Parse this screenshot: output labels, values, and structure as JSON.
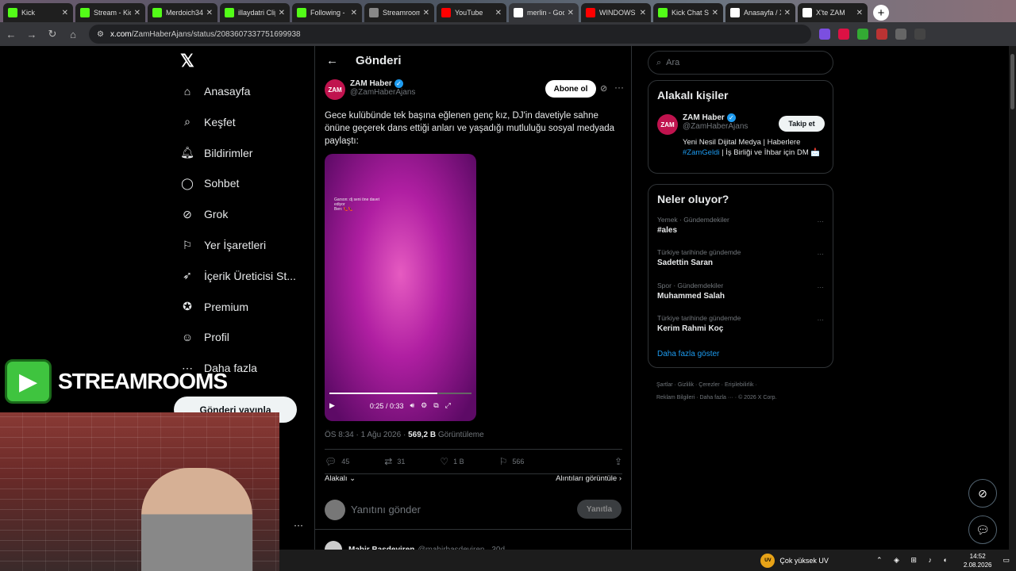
{
  "browser": {
    "tabs": [
      {
        "label": "Kick",
        "icon": "kick-icon",
        "color": "#53fc18"
      },
      {
        "label": "Stream - Kick",
        "icon": "kick-icon",
        "color": "#53fc18"
      },
      {
        "label": "Merdoich34",
        "icon": "kick-icon",
        "color": "#53fc18"
      },
      {
        "label": "illaydatri Clip",
        "icon": "kick-icon",
        "color": "#53fc18"
      },
      {
        "label": "Following -",
        "icon": "kick-icon",
        "color": "#53fc18"
      },
      {
        "label": "Streamroom",
        "icon": "streamroom-icon",
        "color": "#888888"
      },
      {
        "label": "YouTube",
        "icon": "youtube-icon",
        "color": "#ff0000"
      },
      {
        "label": "merlin - Goo",
        "icon": "google-icon",
        "color": "#ffffff"
      },
      {
        "label": "WINDOWS",
        "icon": "youtube-icon",
        "color": "#ff0000"
      },
      {
        "label": "Kick Chat Se",
        "icon": "kick-icon",
        "color": "#53fc18"
      },
      {
        "label": "Anasayfa / X",
        "icon": "x-icon",
        "color": "#ffffff"
      },
      {
        "label": "X'te ZAM",
        "icon": "x-icon",
        "color": "#ffffff"
      }
    ],
    "url_host": "x.com",
    "url_path": "/ZamHaberAjans/status/2083607337751699938"
  },
  "nav": {
    "items": [
      {
        "label": "Anasayfa",
        "icon": "home-icon"
      },
      {
        "label": "Keşfet",
        "icon": "search-icon"
      },
      {
        "label": "Bildirimler",
        "icon": "bell-icon"
      },
      {
        "label": "Sohbet",
        "icon": "chat-icon"
      },
      {
        "label": "Grok",
        "icon": "grok-icon"
      },
      {
        "label": "Yer İşaretleri",
        "icon": "bookmark-icon"
      },
      {
        "label": "İçerik Üreticisi St...",
        "icon": "rocket-icon"
      },
      {
        "label": "Premium",
        "icon": "verified-icon"
      },
      {
        "label": "Profil",
        "icon": "person-icon"
      },
      {
        "label": "Daha fazla",
        "icon": "more-icon"
      }
    ],
    "post_button": "Gönderi yayınla"
  },
  "post": {
    "header": "Gönderi",
    "author_name": "ZAM Haber",
    "author_handle": "@ZamHaberAjans",
    "avatar_text": "ZAM",
    "subscribe": "Abone ol",
    "text": "Gece kulübünde tek başına eğlenen genç kız, DJ'in davetiyle sahne önüne geçerek dans ettiği anları ve yaşadığı mutluluğu sosyal medyada paylaştı:",
    "video_caption_1": "Garson: dj seni öne davet",
    "video_caption_2": "ediyor",
    "video_caption_3": "Ben: 👠👠",
    "video_time": "0:25 / 0:33",
    "video_progress": 0.76,
    "timestamp": "ÖS 8:34 · 1 Ağu 2026 · ",
    "views": "569,2 B",
    "views_label": " Görüntüleme",
    "replies": "45",
    "reposts": "31",
    "likes": "1 B",
    "bookmarks": "566",
    "related": "Alakalı",
    "quotes": "Alıntıları görüntüle",
    "reply_placeholder": "Yanıtını gönder",
    "reply_button": "Yanıtla",
    "next_name": "Mahir Basdeviren",
    "next_handle": "@mahirbasdeviren · 30d"
  },
  "sidebar": {
    "search_placeholder": "Ara",
    "relevant_title": "Alakalı kişiler",
    "relevant_name": "ZAM Haber",
    "relevant_handle": "@ZamHaberAjans",
    "follow_button": "Takip et",
    "bio_1": "Yeni Nesil Dijital Medya | Haberlere",
    "bio_hashtag": "#ZamGeldi",
    "bio_2": " | İş Birliği ve İhbar için DM",
    "bio_3": "📩",
    "trends_title": "Neler oluyor?",
    "trends": [
      {
        "context": "Yemek · Gündemdekiler",
        "title": "#ales"
      },
      {
        "context": "Türkiye tarihinde gündemde",
        "title": "Sadettin Saran"
      },
      {
        "context": "Spor · Gündemdekiler",
        "title": "Muhammed Salah"
      },
      {
        "context": "Türkiye tarihinde gündemde",
        "title": "Kerim Rahmi Koç"
      }
    ],
    "show_more": "Daha fazla göster",
    "footer_1": "Şartlar · Gizlilik · Çerezler · Erişilebilirlik ·",
    "footer_2": "Reklam Bilgileri · Daha fazla ··· · © 2026 X Corp."
  },
  "overlay": {
    "logo_text": "STREAMROOMS"
  },
  "taskbar": {
    "weather": "Çok yüksek UV",
    "weather_badge": "UV",
    "time": "14:52",
    "date": "2.08.2026"
  }
}
